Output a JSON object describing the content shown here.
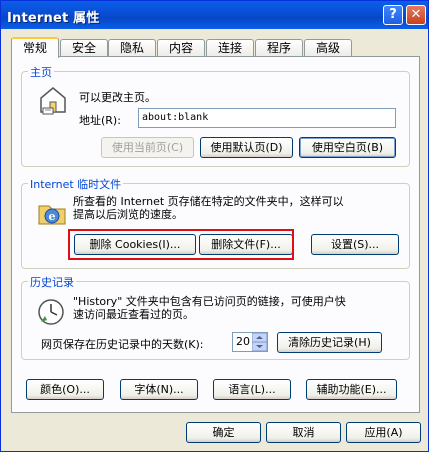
{
  "window": {
    "title": "Internet 属性",
    "help_glyph": "?",
    "close_glyph": "✕"
  },
  "tabs": [
    {
      "label": "常规",
      "active": true
    },
    {
      "label": "安全"
    },
    {
      "label": "隐私"
    },
    {
      "label": "内容"
    },
    {
      "label": "连接"
    },
    {
      "label": "程序"
    },
    {
      "label": "高级"
    }
  ],
  "home": {
    "group_label": "主页",
    "description": "可以更改主页。",
    "address_label": "地址(R):",
    "address_value": "about:blank",
    "use_current": "使用当前页(C)",
    "use_default": "使用默认页(D)",
    "use_blank": "使用空白页(B)"
  },
  "temp": {
    "group_label": "Internet 临时文件",
    "description_line1": "所查看的 Internet 页存储在特定的文件夹中，这样可以",
    "description_line2": "提高以后浏览的速度。",
    "delete_cookies": "删除 Cookies(I)...",
    "delete_files": "删除文件(F)...",
    "settings": "设置(S)..."
  },
  "history": {
    "group_label": "历史记录",
    "description_line1": "\"History\" 文件夹中包含有已访问页的链接，可使用户快",
    "description_line2": "速访问最近查看过的页。",
    "days_label": "网页保存在历史记录中的天数(K):",
    "days_value": "20",
    "clear": "清除历史记录(H)"
  },
  "bottom_buttons": {
    "colors": "颜色(O)...",
    "fonts": "字体(N)...",
    "languages": "语言(L)...",
    "accessibility": "辅助功能(E)..."
  },
  "dialog_buttons": {
    "ok": "确定",
    "cancel": "取消",
    "apply": "应用(A)"
  },
  "colors": {
    "highlight_box": "#e01010",
    "group_label": "#0046d5",
    "titlebar": "#0a5fe8"
  }
}
